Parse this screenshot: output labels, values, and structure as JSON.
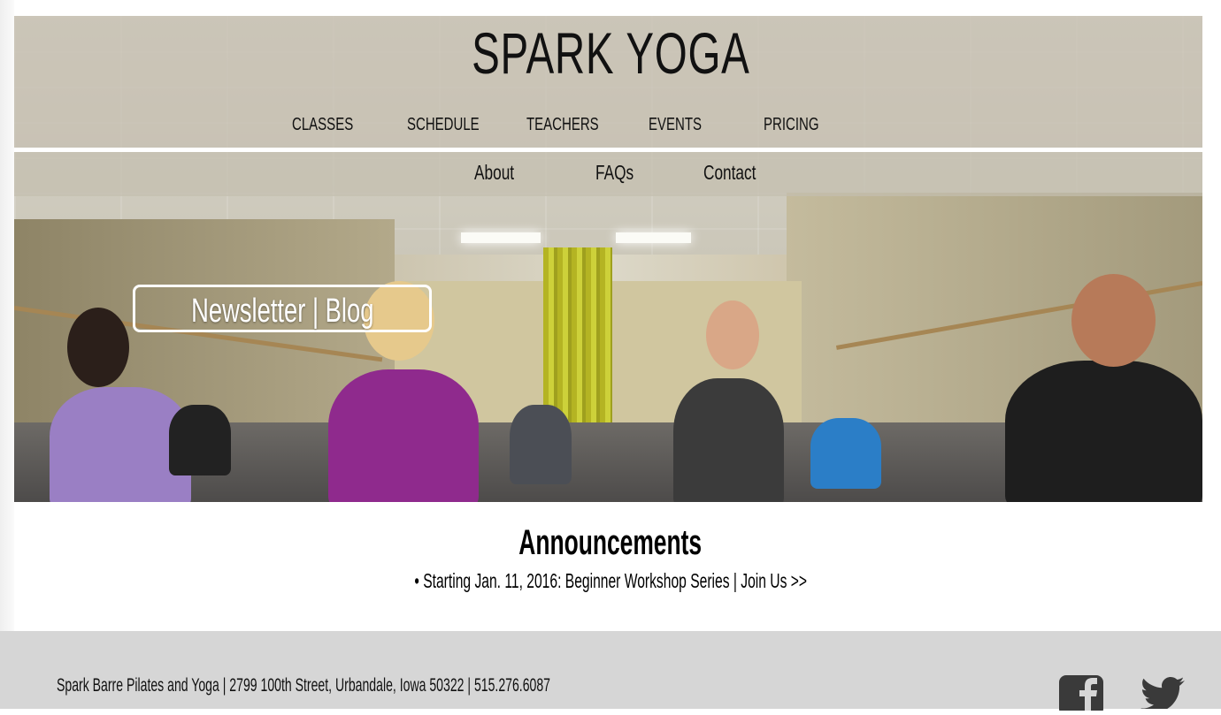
{
  "site": {
    "title": "SPARK YOGA"
  },
  "nav_primary": [
    {
      "label": "CLASSES"
    },
    {
      "label": "SCHEDULE"
    },
    {
      "label": "TEACHERS"
    },
    {
      "label": "EVENTS"
    },
    {
      "label": "PRICING"
    }
  ],
  "nav_secondary": [
    {
      "label": "About"
    },
    {
      "label": "FAQs"
    },
    {
      "label": "Contact"
    }
  ],
  "hero": {
    "button_label": "Newsletter | Blog"
  },
  "announcements": {
    "title": "Announcements",
    "items": [
      {
        "text": "• Starting Jan. 11, 2016: Beginner Workshop Series | Join Us >>"
      }
    ]
  },
  "footer": {
    "address": "Spark Barre Pilates and Yoga | 2799 100th Street, Urbandale, Iowa 50322 | 515.276.6087",
    "social": [
      {
        "icon": "facebook-icon"
      },
      {
        "icon": "twitter-icon"
      }
    ]
  },
  "colors": {
    "header_overlay": "#c4beaf",
    "text": "#111111",
    "footer_bg": "#d6d6d6"
  }
}
